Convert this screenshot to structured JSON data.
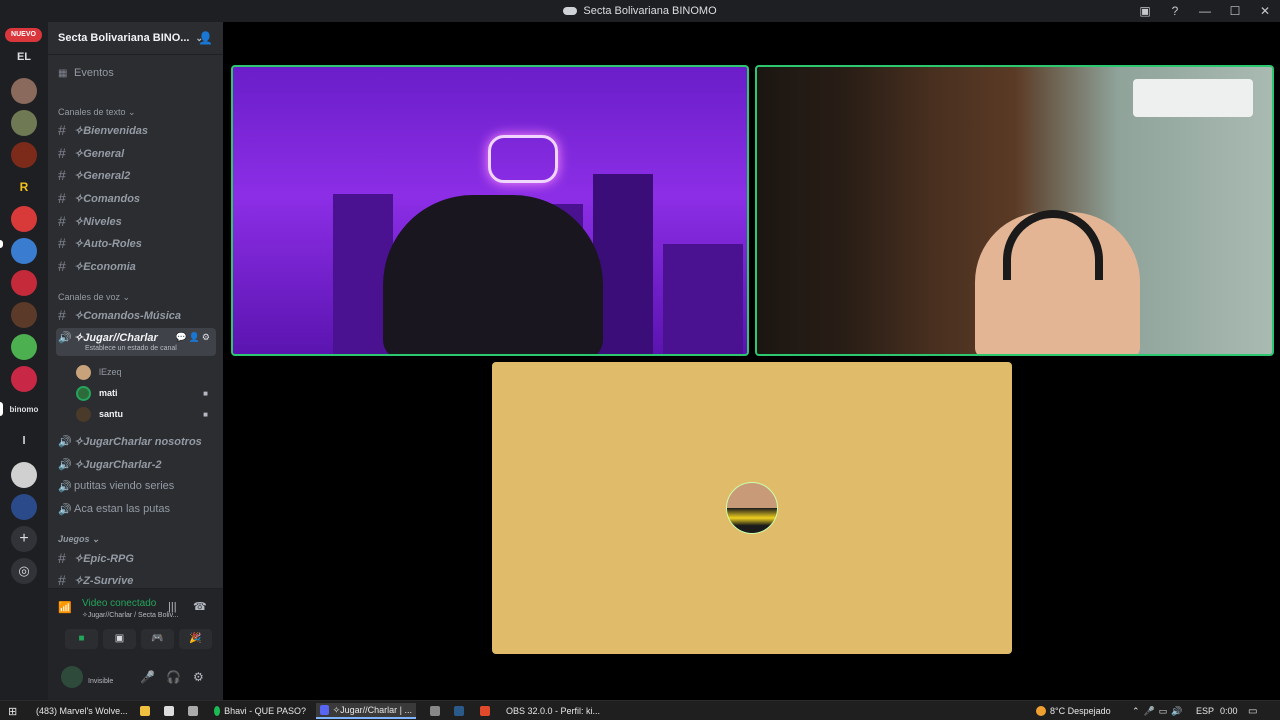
{
  "window": {
    "title": "Secta Bolivariana BINOMO",
    "controls": [
      "▣",
      "?",
      "—",
      "☐",
      "✕"
    ]
  },
  "servers": {
    "new_badge": "NUEVO",
    "initials": [
      "EL",
      "l"
    ],
    "text_logo": "binomo"
  },
  "guild": {
    "name": "Secta Bolivariana BINO...",
    "events_label": "Eventos",
    "text_category": "Canales de texto",
    "text_channels": [
      "✧Bienvenidas",
      "✧General",
      "✧General2",
      "✧Comandos",
      "✧Niveles",
      "✧Auto-Roles",
      "✧Economia"
    ],
    "voice_category": "Canales de voz",
    "voice_channels_top": [
      "✧Comandos-Música"
    ],
    "active_voice": {
      "name": "✧Jugar//Charlar",
      "subtitle": "Establece un estado de canal"
    },
    "members": [
      {
        "name": "lEzeq"
      },
      {
        "name": "mati"
      },
      {
        "name": "santu"
      }
    ],
    "voice_channels_bottom": [
      "✧JugarCharlar nosotros",
      "✧JugarCharlar-2",
      "putitas viendo series",
      "Aca estan las putas"
    ],
    "games_category": "Juegos",
    "games_channels": [
      "✧Epic-RPG",
      "✧Z-Survive"
    ]
  },
  "voice_panel": {
    "status": "Video conectado",
    "channel": "✧Jugar//Charlar / Secta Boliv..."
  },
  "user_panel": {
    "status": "Invisible"
  },
  "taskbar": {
    "apps": [
      {
        "label": "(483) Marvel's Wolve...",
        "color": "#4a90d9"
      },
      {
        "label": "Bhavi - QUE PASO?",
        "color": "#1db954"
      },
      {
        "label": "✧Jugar//Charlar | ...",
        "color": "#5865f2"
      },
      {
        "label": "OBS 32.0.0 - Perfil: ki...",
        "color": "#6a6a6a"
      }
    ],
    "weather": "8°C  Despejado",
    "lang": "ESP",
    "time": "0:00"
  }
}
